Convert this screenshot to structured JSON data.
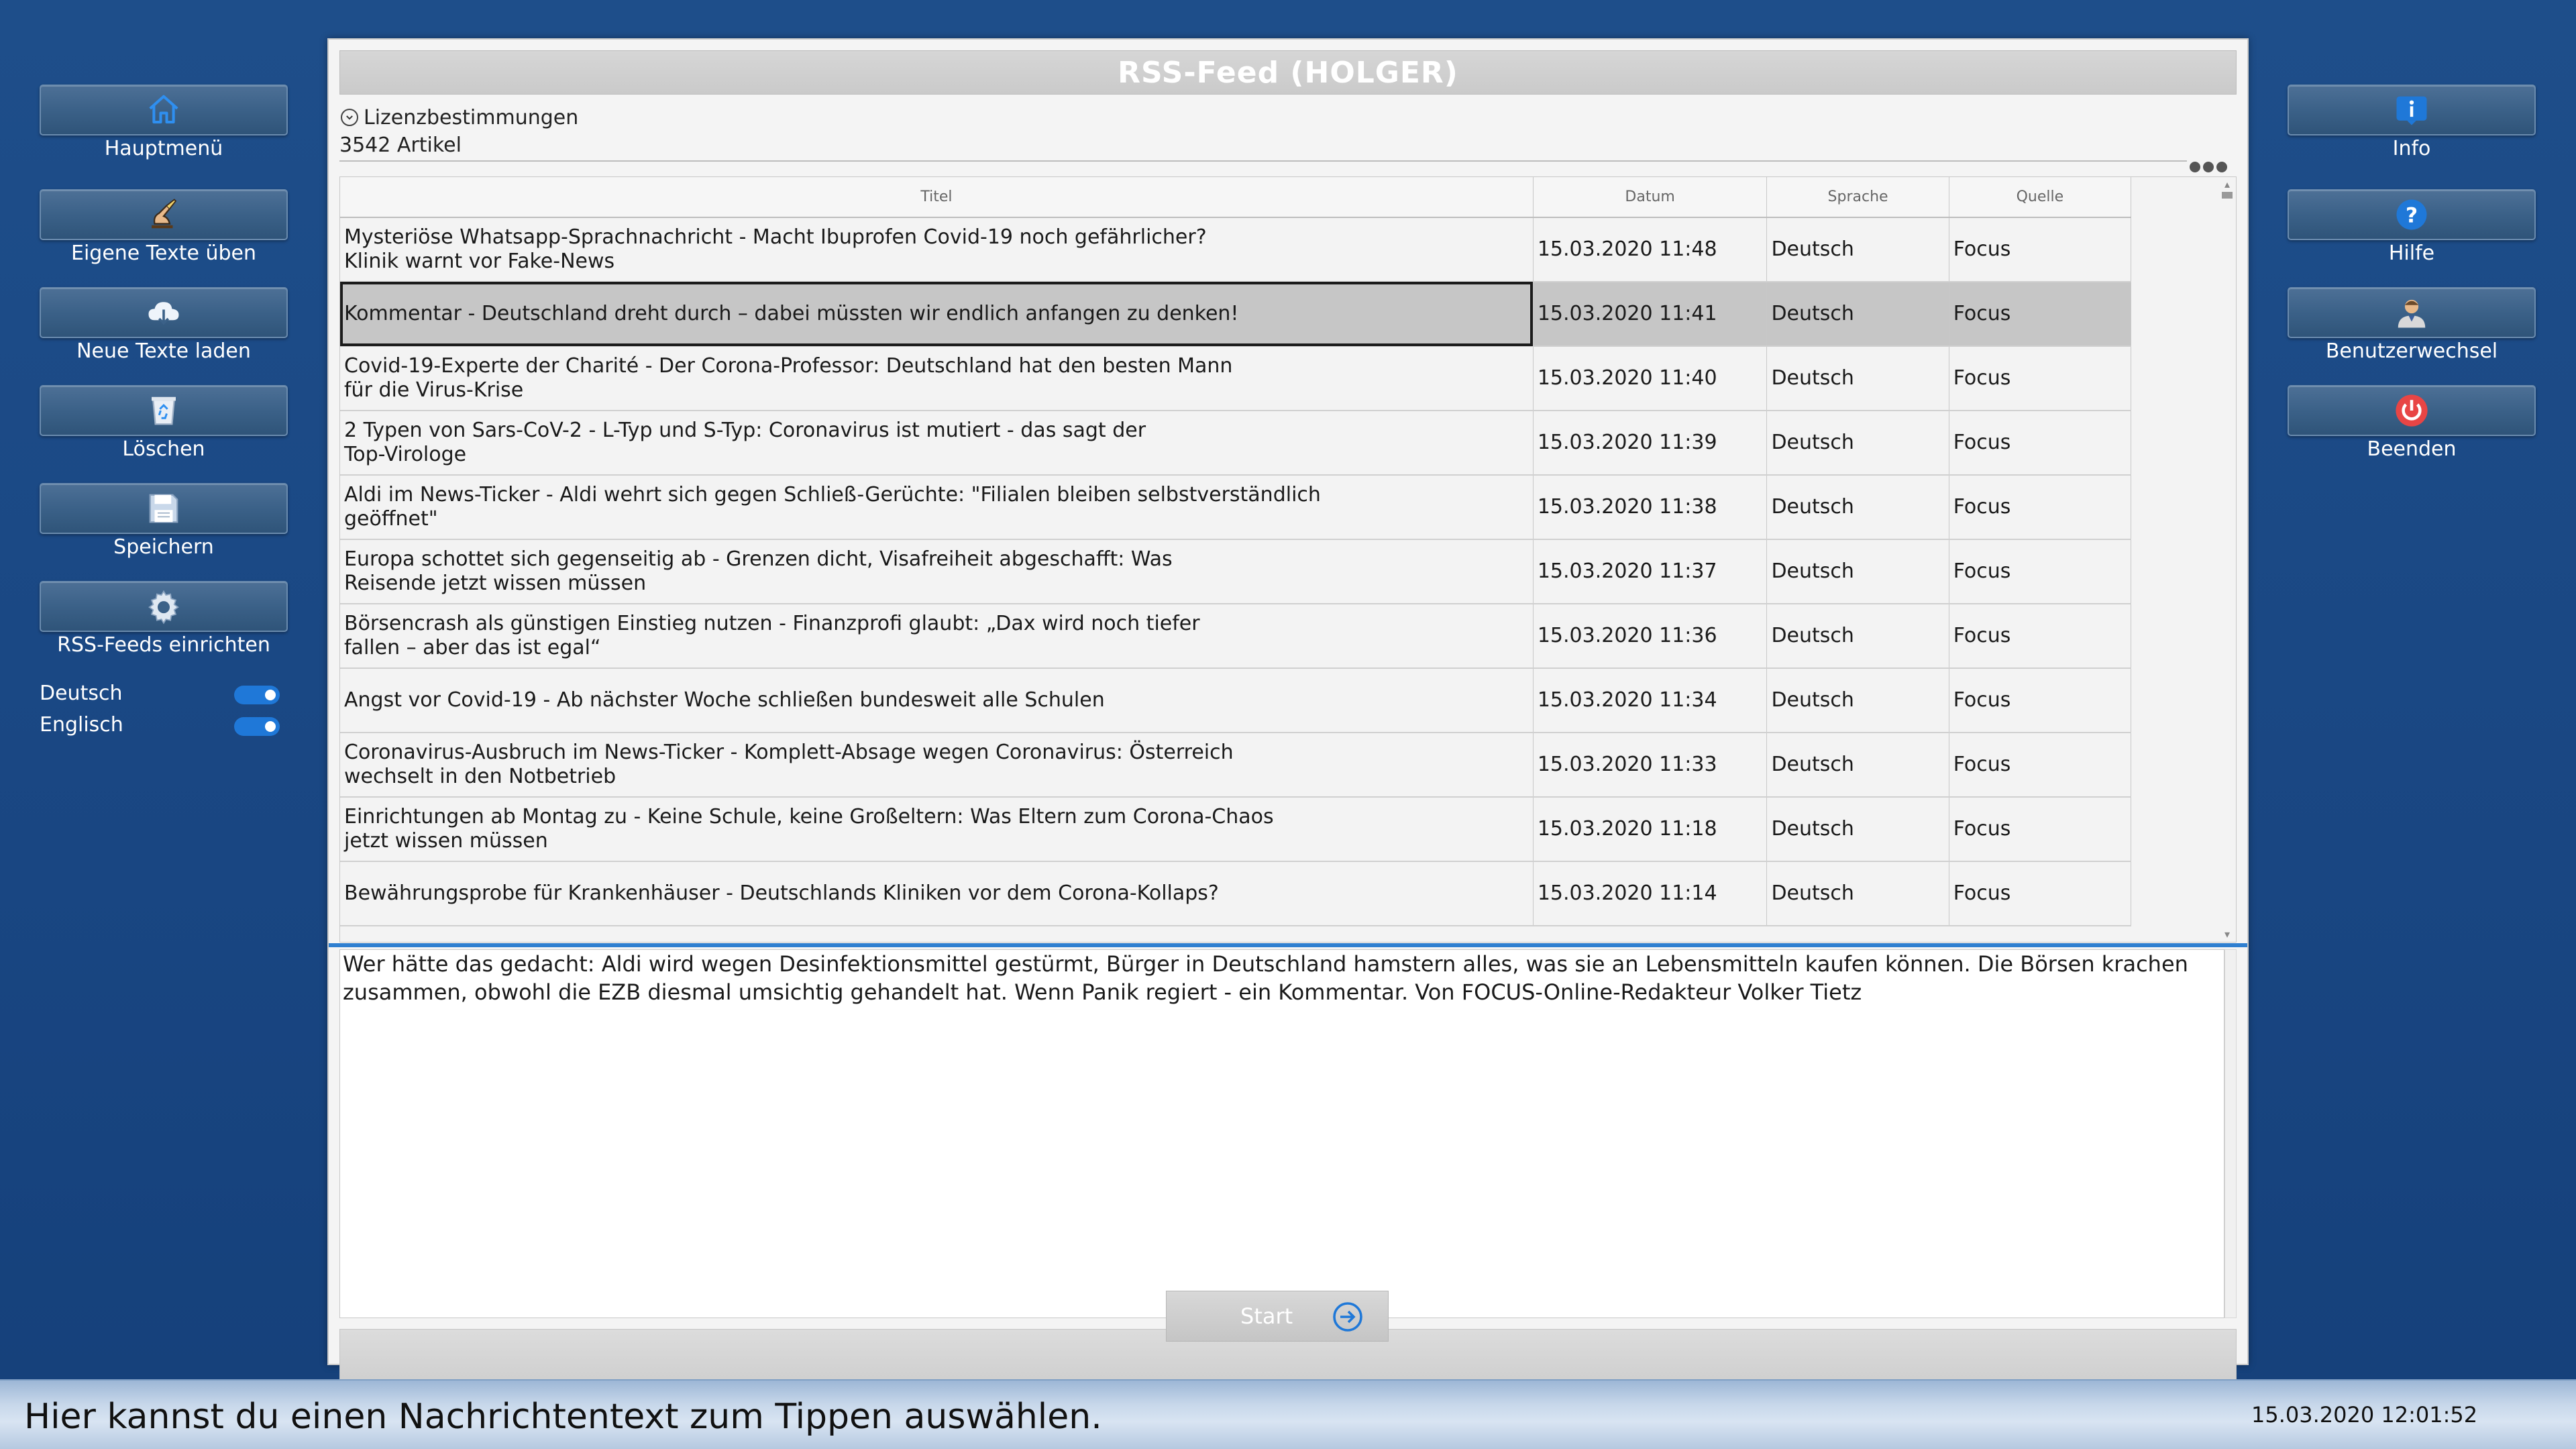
{
  "left_nav": [
    {
      "label": "Hauptmenü",
      "icon": "home-icon"
    },
    {
      "label": "Eigene Texte üben",
      "icon": "writing-hand-icon"
    },
    {
      "label": "Neue Texte laden",
      "icon": "cloud-download-icon"
    },
    {
      "label": "Löschen",
      "icon": "recycle-bin-icon"
    },
    {
      "label": "Speichern",
      "icon": "floppy-disk-icon"
    },
    {
      "label": "RSS-Feeds einrichten",
      "icon": "gear-icon"
    }
  ],
  "language_toggles": [
    {
      "label": "Deutsch",
      "on": true
    },
    {
      "label": "Englisch",
      "on": true
    }
  ],
  "right_nav": [
    {
      "label": "Info",
      "icon": "info-icon"
    },
    {
      "label": "Hilfe",
      "icon": "help-icon"
    },
    {
      "label": "Benutzerwechsel",
      "icon": "user-icon"
    },
    {
      "label": "Beenden",
      "icon": "power-icon"
    }
  ],
  "window": {
    "title": "RSS-Feed (HOLGER)",
    "license_label": "Lizenzbestimmungen",
    "article_count": "3542 Artikel"
  },
  "table": {
    "columns": [
      "Titel",
      "Datum",
      "Sprache",
      "Quelle"
    ],
    "selected_index": 1,
    "rows": [
      {
        "title": "Mysteriöse Whatsapp-Sprachnachricht - Macht Ibuprofen Covid-19 noch gefährlicher?\nKlinik warnt vor Fake-News",
        "date": "15.03.2020 11:48",
        "language": "Deutsch",
        "source": "Focus"
      },
      {
        "title": "Kommentar - Deutschland dreht durch – dabei müssten wir endlich anfangen zu denken!",
        "date": "15.03.2020 11:41",
        "language": "Deutsch",
        "source": "Focus"
      },
      {
        "title": "Covid-19-Experte der Charité - Der Corona-Professor: Deutschland hat den besten Mann\nfür die Virus-Krise",
        "date": "15.03.2020 11:40",
        "language": "Deutsch",
        "source": "Focus"
      },
      {
        "title": "2 Typen von Sars-CoV-2 - L-Typ und S-Typ: Coronavirus ist mutiert - das sagt der\nTop-Virologe",
        "date": "15.03.2020 11:39",
        "language": "Deutsch",
        "source": "Focus"
      },
      {
        "title": "Aldi im News-Ticker - Aldi wehrt sich gegen Schließ-Gerüchte: \"Filialen bleiben selbstverständlich\ngeöffnet\"",
        "date": "15.03.2020 11:38",
        "language": "Deutsch",
        "source": "Focus"
      },
      {
        "title": "Europa schottet sich gegenseitig ab - Grenzen dicht, Visafreiheit abgeschafft: Was\nReisende jetzt wissen müssen",
        "date": "15.03.2020 11:37",
        "language": "Deutsch",
        "source": "Focus"
      },
      {
        "title": "Börsencrash als günstigen Einstieg nutzen - Finanzprofi glaubt: „Dax wird noch tiefer\nfallen – aber das ist egal“",
        "date": "15.03.2020 11:36",
        "language": "Deutsch",
        "source": "Focus"
      },
      {
        "title": "Angst vor Covid-19 - Ab nächster Woche schließen bundesweit alle Schulen",
        "date": "15.03.2020 11:34",
        "language": "Deutsch",
        "source": "Focus"
      },
      {
        "title": "Coronavirus-Ausbruch im News-Ticker - Komplett-Absage wegen Coronavirus: Österreich\nwechselt in den Notbetrieb",
        "date": "15.03.2020 11:33",
        "language": "Deutsch",
        "source": "Focus"
      },
      {
        "title": "Einrichtungen ab Montag zu - Keine Schule, keine Großeltern: Was Eltern zum Corona-Chaos\njetzt wissen müssen",
        "date": "15.03.2020 11:18",
        "language": "Deutsch",
        "source": "Focus"
      },
      {
        "title": "Bewährungsprobe für Krankenhäuser - Deutschlands Kliniken vor dem Corona-Kollaps?",
        "date": "15.03.2020 11:14",
        "language": "Deutsch",
        "source": "Focus"
      }
    ]
  },
  "detail_text": "Wer hätte das gedacht: Aldi wird wegen Desinfektionsmittel gestürmt, Bürger in Deutschland hamstern alles, was sie an Lebensmitteln kaufen können. Die Börsen krachen zusammen, obwohl die EZB diesmal umsichtig gehandelt hat. Wenn Panik regiert - ein Kommentar. Von FOCUS-Online-Redakteur Volker Tietz",
  "start_button": {
    "label": "Start",
    "icon": "arrow-right-circle-icon"
  },
  "status": {
    "message": "Hier kannst du einen Nachrichtentext zum Tippen auswählen.",
    "datetime": "15.03.2020 12:01:52"
  },
  "colors": {
    "background": "#1e4e8a",
    "toggle_on": "#1f78d8",
    "splitter": "#2f7fd0",
    "selected_row": "#c6c6c6"
  }
}
